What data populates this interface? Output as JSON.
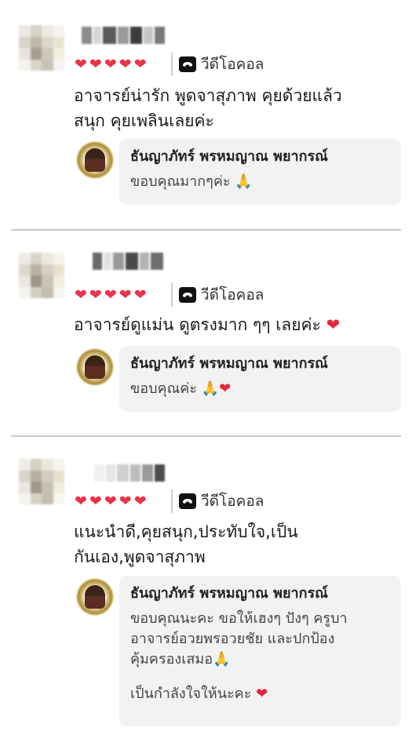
{
  "reviews": [
    {
      "rating": 5,
      "call_label": "วีดีโอคอล",
      "text": "อาจารย์น่ารัก พูดจาสุภาพ คุยด้วยแล้ว\nสนุก คุยเพลินเลยค่ะ",
      "reply_name": "ธันญาภัทร์ พรหมญาณ พยากรณ์",
      "reply_text": "ขอบคุณมากๆค่ะ",
      "reply_emoji": "🙏"
    },
    {
      "rating": 5,
      "call_label": "วีดีโอคอล",
      "text": "อาจารย์ดูแม่น ดูตรงมาก ๆๆ เลยค่ะ",
      "text_emoji": "❤",
      "reply_name": "ธันญาภัทร์ พรหมญาณ พยากรณ์",
      "reply_text": "ขอบคุณค่ะ",
      "reply_emoji": "🙏",
      "reply_emoji2": "❤"
    },
    {
      "rating": 5,
      "call_label": "วีดีโอคอล",
      "text": "แนะนำดี,คุยสนุก,ประทับใจ,เป็น\nกันเอง,พูดจาสุภาพ",
      "reply_name": "ธันญาภัทร์ พรหมญาณ พยากรณ์",
      "reply_text": "ขอบคุณนะคะ ขอให้เฮงๆ ปังๆ ครูบา\nอาจารย์อวยพรอวยชัย และปกป้อง\nคุ้มครองเสมอ",
      "reply_emoji": "🙏",
      "reply_text_2": "เป็นกำลังใจให้นะคะ",
      "reply_emoji_2": "❤"
    }
  ],
  "colors": {
    "heart": "#e8354a",
    "bubble": "#f2f2f2",
    "divider": "#c9c9c9"
  },
  "icons": {
    "rating": "heart-icon",
    "call": "video-call-icon",
    "pray": "folded-hands-emoji",
    "love": "red-heart-emoji"
  }
}
